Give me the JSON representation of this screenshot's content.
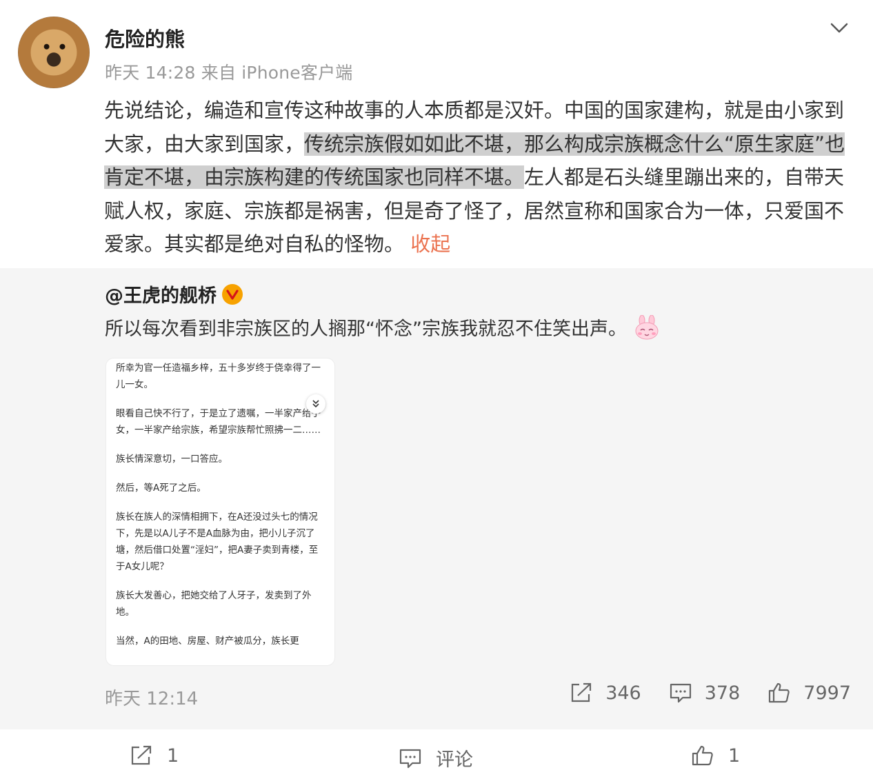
{
  "post": {
    "author": "危险的熊",
    "meta": "昨天 14:28 来自 iPhone客户端",
    "text_part1": "先说结论，编造和宣传这种故事的人本质都是汉奸。中国的国家建构，就是由小家到大家，由大家到国家，",
    "text_highlight": "传统宗族假如如此不堪，那么构成宗族概念什么“原生家庭”也肯定不堪，由宗族构建的传统国家也同样不堪。",
    "text_part2": "左人都是石头缝里蹦出来的，自带天赋人权，家庭、宗族都是祸害，但是奇了怪了，居然宣称和国家合为一体，只爱国不爱家。其实都是绝对自私的怪物。",
    "collapse_label": "收起"
  },
  "repost": {
    "author": "@王虎的舰桥",
    "text": "所以每次看到非宗族区的人搁那“怀念”宗族我就忍不住笑出声。",
    "image_lines": [
      "所幸为官一任造福乡梓，五十多岁终于侥幸得了一儿一女。",
      "眼看自己快不行了，于是立了遗嘱，一半家产给子女，一半家产给宗族，希望宗族帮忙照拂一二……",
      "族长情深意切，一口答应。",
      "然后，等A死了之后。",
      "族长在族人的深情相拥下，在A还没过头七的情况下，先是以A儿子不是A血脉为由，把小儿子沉了塘，然后借口处置“淫妇”，把A妻子卖到青楼，至于A女儿呢？",
      "族长大发善心，把她交给了人牙子，发卖到了外地。",
      "当然，A的田地、房屋、财产被瓜分，族长更"
    ],
    "time": "昨天 12:14",
    "repost_count": "346",
    "comment_count": "378",
    "like_count": "7997"
  },
  "bottom_bar": {
    "repost_count": "1",
    "comment_label": "评论",
    "like_count": "1"
  },
  "colors": {
    "accent": "#eb7350",
    "highlight": "#cfcfcf",
    "repost_bg": "#f5f5f5",
    "meta_gray": "#999999"
  }
}
